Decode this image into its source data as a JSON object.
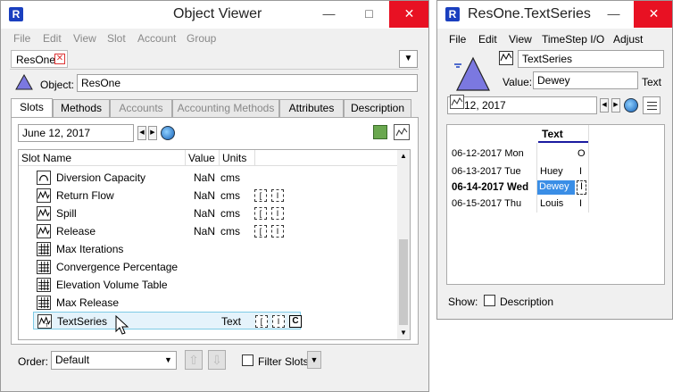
{
  "object_viewer": {
    "title": "Object Viewer",
    "menu": [
      "File",
      "Edit",
      "View",
      "Slot",
      "Account",
      "Group"
    ],
    "open_tab": "ResOne",
    "object_label": "Object:",
    "object_value": "ResOne",
    "tabs": [
      "Slots",
      "Methods",
      "Accounts",
      "Accounting Methods",
      "Attributes",
      "Description"
    ],
    "date": "June 12, 2017",
    "columns": {
      "name": "Slot Name",
      "value": "Value",
      "units": "Units"
    },
    "slots": [
      {
        "name": "Diversion Capacity",
        "value": "NaN",
        "units": "cms",
        "icon": "curve-icon"
      },
      {
        "name": "Return Flow",
        "value": "NaN",
        "units": "cms",
        "icon": "series-icon"
      },
      {
        "name": "Spill",
        "value": "NaN",
        "units": "cms",
        "icon": "series-icon"
      },
      {
        "name": "Release",
        "value": "NaN",
        "units": "cms",
        "icon": "series-icon"
      },
      {
        "name": "Max Iterations",
        "value": "",
        "units": "",
        "icon": "table-icon"
      },
      {
        "name": "Convergence Percentage",
        "value": "",
        "units": "",
        "icon": "table-icon"
      },
      {
        "name": "Elevation Volume Table",
        "value": "",
        "units": "",
        "icon": "table-icon"
      },
      {
        "name": "Max Release",
        "value": "",
        "units": "",
        "icon": "table-icon"
      },
      {
        "name": "TextSeries",
        "value": "",
        "units": "Text",
        "icon": "text-series-icon"
      }
    ],
    "order_label": "Order:",
    "order_value": "Default",
    "filter_label": "Filter Slots",
    "flag_c": "C"
  },
  "text_series": {
    "title": "ResOne.TextSeries",
    "menu": [
      "File",
      "Edit",
      "View",
      "TimeStep I/O",
      "Adjust"
    ],
    "slot_name": "TextSeries",
    "value_label": "Value:",
    "value": "Dewey",
    "value_type": "Text",
    "date": "12, 2017",
    "column_header": "Text",
    "rows": [
      {
        "date": "06-12-2017 Mon",
        "value": "",
        "flag": "O",
        "bold": false
      },
      {
        "date": "06-13-2017 Tue",
        "value": "Huey",
        "flag": "I",
        "bold": false
      },
      {
        "date": "06-14-2017 Wed",
        "value": "Dewey",
        "flag": "I",
        "bold": true
      },
      {
        "date": "06-15-2017 Thu",
        "value": "Louis",
        "flag": "I",
        "bold": false
      }
    ],
    "show_label": "Show:",
    "description_label": "Description"
  }
}
